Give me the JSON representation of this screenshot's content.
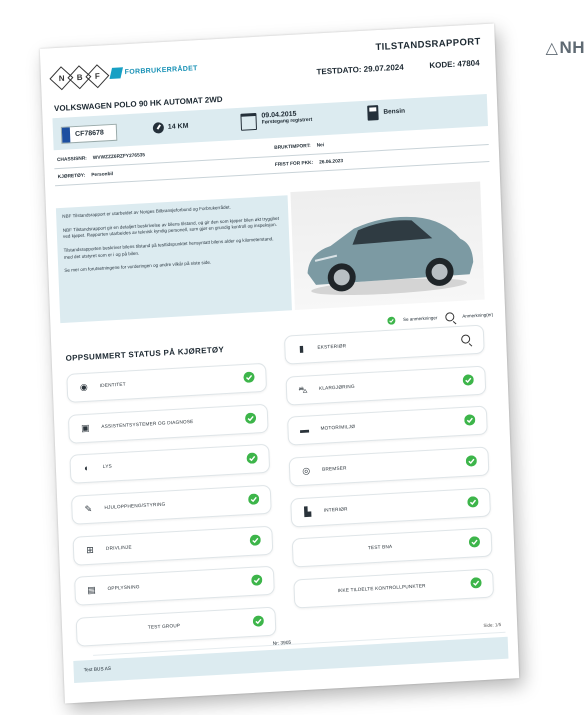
{
  "corner_logo": {
    "text": "NH",
    "icon": "triangle-logo-icon"
  },
  "header": {
    "doc_title": "TILSTANDSRAPPORT",
    "brand_partner": "FORBRUKERRÅDET",
    "nbf_letters": [
      "N",
      "B",
      "F"
    ],
    "testdato": "TESTDATO: 29.07.2024",
    "kode": "KODE: 47804"
  },
  "vehicle": {
    "name": "VOLKSWAGEN POLO 90 HK AUTOMAT 2WD",
    "plate": "CF78678",
    "km": "14 KM",
    "reg_date": "09.04.2015",
    "reg_label": "Førstegang registrert",
    "fuel": "Bensin"
  },
  "details": {
    "chassis_label": "CHASSISNR:",
    "chassis_value": "WVWZZZ6RZFY276535",
    "bruktimport_label": "BRUKTIMPORT:",
    "bruktimport_value": "Nei",
    "kjoretoy_label": "KJØRETØY:",
    "kjoretoy_value": "Personbil",
    "frist_label": "FRIST FOR PKK:",
    "frist_value": "26.06.2023"
  },
  "intro": {
    "p1": "NBF Tilstandsrapport er utarbeidet av Norges Bilbransjeforbund og Forbrukerrådet.",
    "p2": "NBF Tilstandsrapport gir en detaljert beskrivelse av bilens tilstand, og gir den som kjøper bilen økt trygghet ved kjøpet. Rapporten utarbeides av teknisk kyndig personell, som gjør en grundig kontroll og inspeksjon.",
    "p3": "Tilstandsrapporten beskriver bilens tilstand på testtidspunktet hensyntatt bilens alder og kilometerstand, med det utstyret som er i og på bilen.",
    "p4": "Se mer om forutsetningene for vurderingen og andre vilkår på siste side."
  },
  "legend": {
    "ok_label": "Se anmerkninger",
    "search_label": "Anmerkning(er)"
  },
  "summary": {
    "title": "OPPSUMMERT STATUS PÅ KJØRETØY",
    "left": [
      {
        "label": "IDENTITET",
        "icon": "identity-icon",
        "glyph": "◉"
      },
      {
        "label": "ASSISTENTSYSTEMER OG DIAGNOSE",
        "icon": "assistant-icon",
        "glyph": "▣"
      },
      {
        "label": "LYS",
        "icon": "light-icon",
        "glyph": "◐"
      },
      {
        "label": "HJULOPPHENG/STYRING",
        "icon": "wrench-icon",
        "glyph": "✎"
      },
      {
        "label": "DRIVLINJE",
        "icon": "drivetrain-icon",
        "glyph": "⊞"
      },
      {
        "label": "OPPLYSNING",
        "icon": "document-icon",
        "glyph": "▤"
      },
      {
        "label": "TEST GROUP",
        "icon": "",
        "glyph": ""
      }
    ],
    "right": [
      {
        "label": "EKSTERIØR",
        "icon": "door-icon",
        "glyph": "▮",
        "status": "search"
      },
      {
        "label": "KLARGJØRING",
        "icon": "car-icon",
        "glyph": "⛍"
      },
      {
        "label": "MOTOR/MILJØ",
        "icon": "engine-icon",
        "glyph": "▬"
      },
      {
        "label": "BREMSER",
        "icon": "brake-icon",
        "glyph": "◎"
      },
      {
        "label": "INTERIØR",
        "icon": "seat-icon",
        "glyph": "▙"
      },
      {
        "label": "TEST BNA",
        "icon": "",
        "glyph": ""
      },
      {
        "label": "IKKE TILDELTE KONTROLLPUNKTER",
        "icon": "",
        "glyph": ""
      }
    ]
  },
  "footer": {
    "company": "Test BUS AS",
    "nr": "Nr: 3905",
    "side": "Side: 1/5"
  },
  "colors": {
    "band": "#dcebf0",
    "ok_green": "#3db54a",
    "brand_blue": "#17a0c4"
  }
}
